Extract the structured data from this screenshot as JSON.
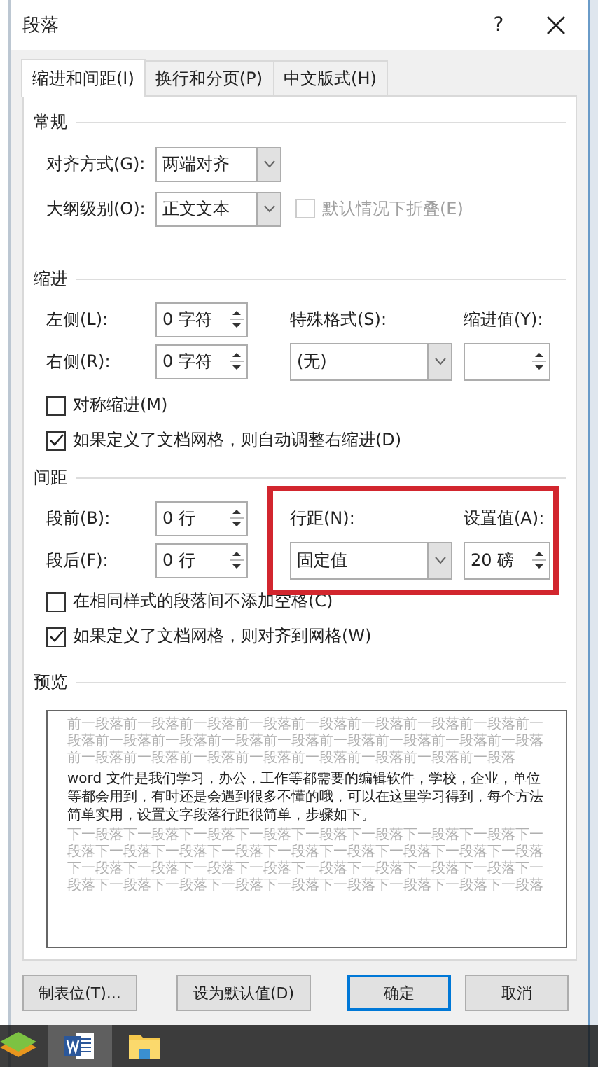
{
  "window": {
    "title": "段落",
    "help": "?"
  },
  "tabs": [
    {
      "label": "缩进和间距(I)",
      "selected": true
    },
    {
      "label": "换行和分页(P)",
      "selected": false
    },
    {
      "label": "中文版式(H)",
      "selected": false
    }
  ],
  "general": {
    "title": "常规",
    "alignment": {
      "label": "对齐方式(G):",
      "value": "两端对齐"
    },
    "outline_level": {
      "label": "大纲级别(O):",
      "value": "正文文本"
    },
    "collapse": {
      "label": "默认情况下折叠(E)",
      "checked": false,
      "disabled": true
    }
  },
  "indent": {
    "title": "缩进",
    "left": {
      "label": "左侧(L):",
      "value": "0 字符"
    },
    "right": {
      "label": "右侧(R):",
      "value": "0 字符"
    },
    "special": {
      "label": "特殊格式(S):",
      "value": "(无)"
    },
    "by": {
      "label": "缩进值(Y):"
    },
    "mirror": {
      "label": "对称缩进(M)",
      "checked": false,
      "disabled": false
    },
    "auto_adjust": {
      "label": "如果定义了文档网格，则自动调整右缩进(D)",
      "checked": true,
      "disabled": false
    }
  },
  "spacing": {
    "title": "间距",
    "before": {
      "label": "段前(B):",
      "value": "0 行"
    },
    "after": {
      "label": "段后(F):",
      "value": "0 行"
    },
    "line_spacing": {
      "label": "行距(N):",
      "value": "固定值"
    },
    "at": {
      "label": "设置值(A):",
      "value": "20 磅"
    },
    "no_space": {
      "label": "在相同样式的段落间不添加空格(C)",
      "checked": false,
      "disabled": false
    },
    "snap": {
      "label": "如果定义了文档网格，则对齐到网格(W)",
      "checked": true,
      "disabled": false
    }
  },
  "preview": {
    "title": "预览",
    "previous_text": "前一段落前一段落前一段落前一段落前一段落前一段落前一段落前一段落前一段落前一段落前一段落前一段落前一段落前一段落前一段落前一段落前一段落前一段落前一段落前一段落前一段落前一段落前一段落前一段落前一段落",
    "sample_text": "word 文件是我们学习，办公，工作等都需要的编辑软件，学校，企业，单位等都会用到，有时还是会遇到很多不懂的哦，可以在这里学习得到，每个方法简单实用，设置文字段落行距很简单，步骤如下。",
    "next_text": "下一段落下一段落下一段落下一段落下一段落下一段落下一段落下一段落下一段落下一段落下一段落下一段落下一段落下一段落下一段落下一段落下一段落下一段落下一段落下一段落下一段落下一段落下一段落下一段落下一段落下一段落下一段落下一段落下一段落下一段落下一段落下一段落下一段落下一段落"
  },
  "buttons": [
    {
      "label": "制表位(T)...",
      "default": false
    },
    {
      "label": "设为默认值(D)",
      "default": false
    },
    {
      "label": "确定",
      "default": true
    },
    {
      "label": "取消",
      "default": false
    }
  ]
}
